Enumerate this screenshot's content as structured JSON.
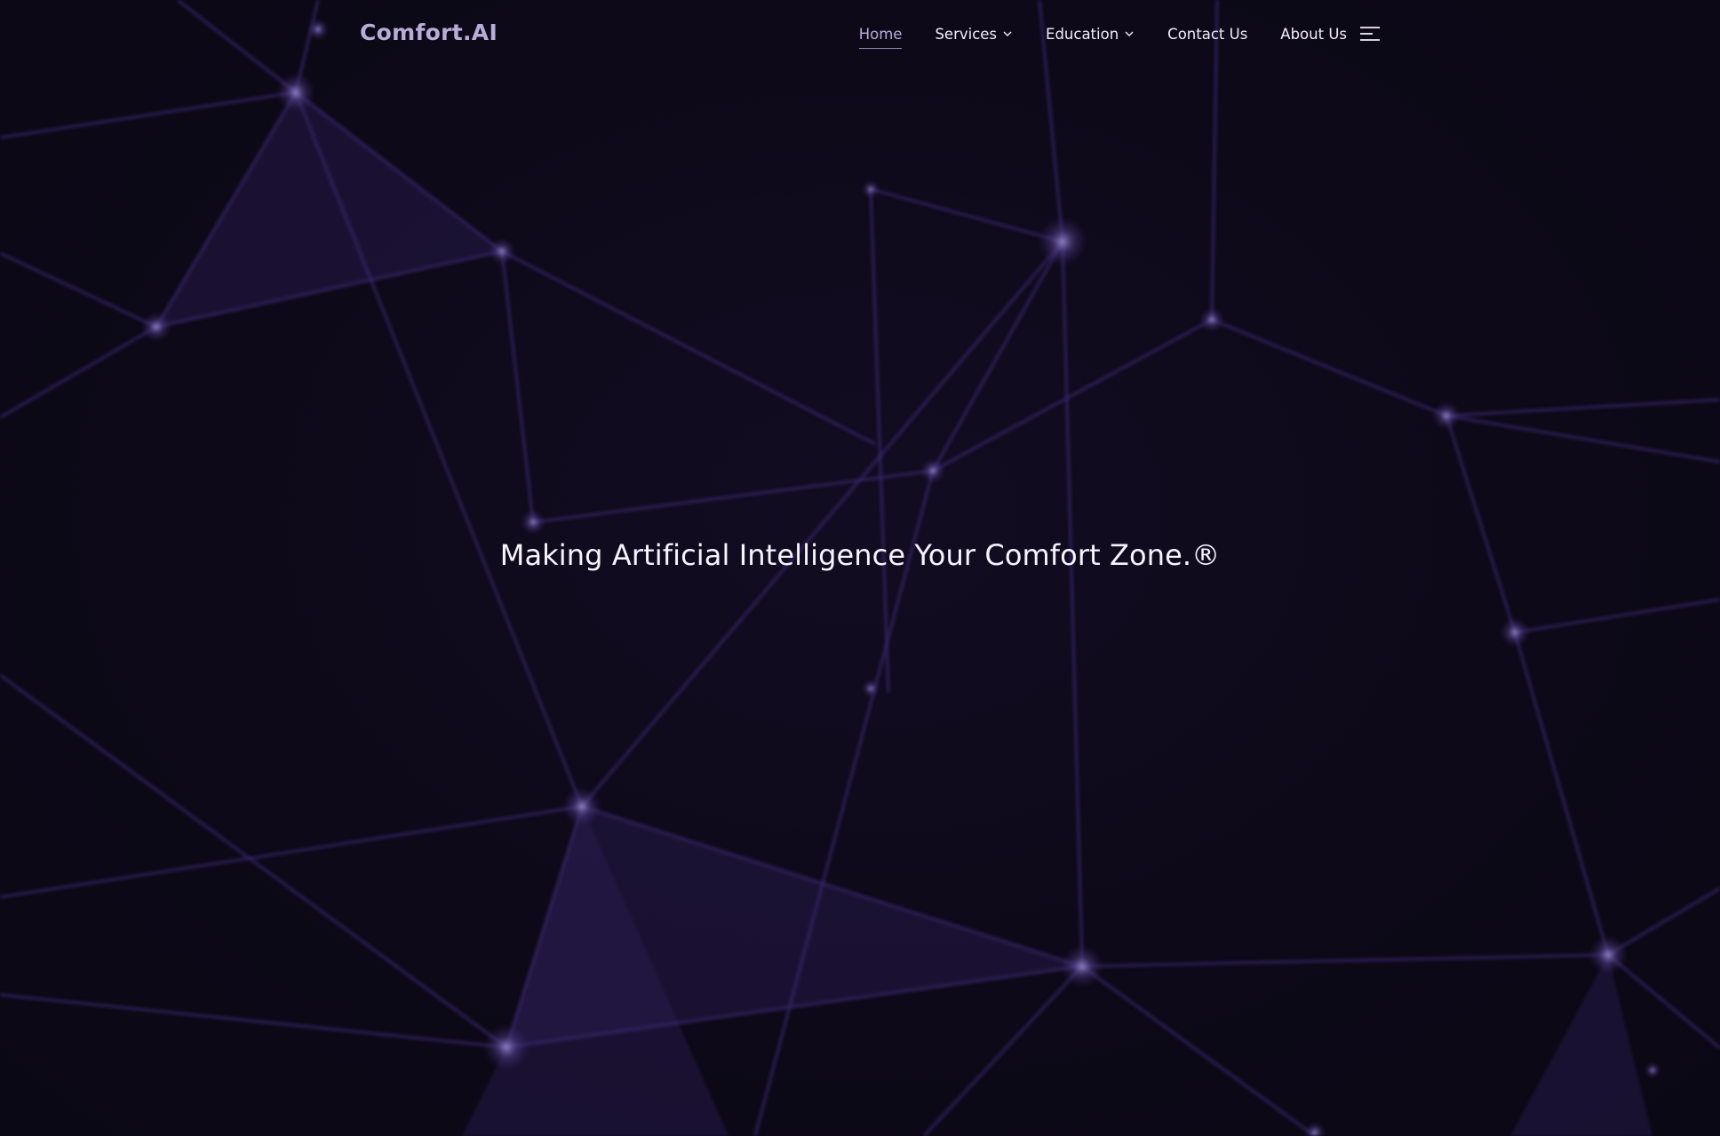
{
  "site": {
    "logo": "Comfort.AI"
  },
  "nav": {
    "items": [
      {
        "label": "Home",
        "active": true,
        "dropdown": false
      },
      {
        "label": "Services",
        "active": false,
        "dropdown": true
      },
      {
        "label": "Education",
        "active": false,
        "dropdown": true
      },
      {
        "label": "Contact Us",
        "active": false,
        "dropdown": false
      },
      {
        "label": "About Us",
        "active": false,
        "dropdown": false
      }
    ],
    "menu_icon": "hamburger-menu-icon",
    "dropdown_icon": "chevron-down-icon"
  },
  "hero": {
    "title": "Making Artificial Intelligence Your Comfort Zone.®"
  },
  "colors": {
    "background": "#0e0a1a",
    "logo": "#b9acd8",
    "nav_text": "#f2eefb",
    "nav_active": "#b8addb",
    "network": "#3a2870"
  }
}
